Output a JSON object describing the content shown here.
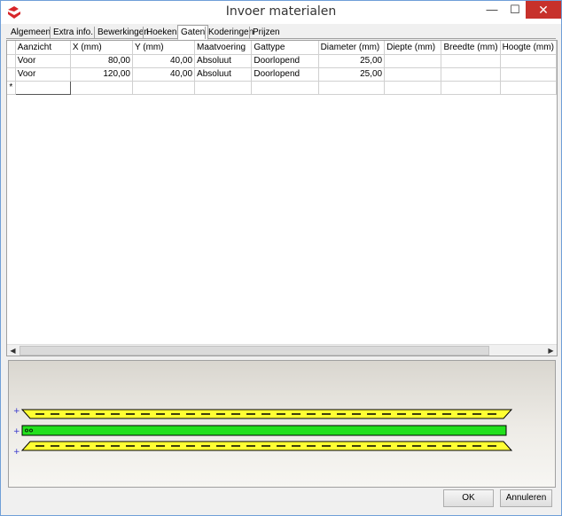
{
  "window": {
    "title": "Invoer materialen",
    "minimize_glyph": "—",
    "maximize_glyph": "☐",
    "close_glyph": "✕"
  },
  "tabs": [
    {
      "label": "Algemeen",
      "active": false
    },
    {
      "label": "Extra info.",
      "active": false
    },
    {
      "label": "Bewerkingen",
      "active": false
    },
    {
      "label": "Hoeken",
      "active": false
    },
    {
      "label": "Gaten",
      "active": true
    },
    {
      "label": "Koderingen",
      "active": false
    },
    {
      "label": "Prijzen",
      "active": false
    }
  ],
  "grid": {
    "columns": [
      "Aanzicht",
      "X (mm)",
      "Y (mm)",
      "Maatvoering",
      "Gattype",
      "Diameter (mm)",
      "Diepte (mm)",
      "Breedte (mm)",
      "Hoogte (mm)"
    ],
    "rows": [
      {
        "aanzicht": "Voor",
        "x": "80,00",
        "y": "40,00",
        "maatvoering": "Absoluut",
        "gattype": "Doorlopend",
        "diameter": "25,00",
        "diepte": "",
        "breedte": "",
        "hoogte": ""
      },
      {
        "aanzicht": "Voor",
        "x": "120,00",
        "y": "40,00",
        "maatvoering": "Absoluut",
        "gattype": "Doorlopend",
        "diameter": "25,00",
        "diepte": "",
        "breedte": "",
        "hoogte": ""
      }
    ],
    "new_row_marker": "*"
  },
  "scrollbar": {
    "left_glyph": "◀",
    "right_glyph": "▶"
  },
  "preview": {
    "colors": {
      "profile": "#ffff33",
      "body": "#22e01c",
      "outline": "#000000",
      "marker": "#3333cc"
    },
    "markers": [
      "+",
      "+",
      "+"
    ]
  },
  "buttons": {
    "ok": "OK",
    "cancel": "Annuleren"
  }
}
